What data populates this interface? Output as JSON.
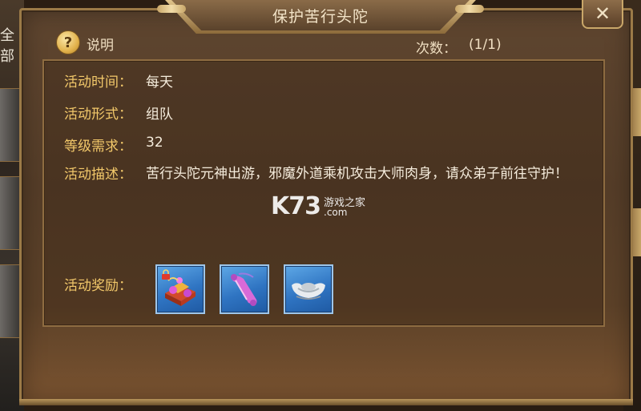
{
  "background": {
    "left_text": "全部"
  },
  "dialog": {
    "title": "保护苦行头陀",
    "close_symbol": "✕"
  },
  "help": {
    "icon": "?",
    "label": "说明"
  },
  "count": {
    "label": "次数：",
    "value": "(1/1)"
  },
  "info": {
    "time_label": "活动时间：",
    "time_value": "每天",
    "form_label": "活动形式：",
    "form_value": "组队",
    "level_label": "等级需求：",
    "level_value": "32",
    "desc_label": "活动描述：",
    "desc_value": "苦行头陀元神出游，邪魔外道乘机攻击大师肉身，请众弟子前往守护！",
    "reward_label": "活动奖励："
  },
  "rewards": [
    {
      "icon": "gift-pack-icon",
      "locked": true
    },
    {
      "icon": "scroll-icon",
      "locked": false
    },
    {
      "icon": "silver-ingot-icon",
      "locked": false
    }
  ],
  "watermark": {
    "brand": "K73",
    "cn": "游戏之家",
    "domain": ".com"
  },
  "colors": {
    "label": "#f2c86a",
    "value": "#f5ecdc",
    "frame": "#9b7a47",
    "reward_bg": "#2f74c2"
  }
}
